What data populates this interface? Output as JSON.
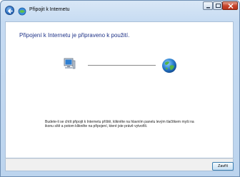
{
  "window": {
    "title": "Připojit k Internetu"
  },
  "main": {
    "heading": "Připojení k Internetu je připraveno k použití.",
    "info_text": "Budete-li se chtít připojit k Internetu příště, klikněte na hlavním panelu levým tlačítkem myši na ikonu sítě a potom klikněte na připojení, které jste právě vytvořili."
  },
  "footer": {
    "close_label": "Zavřít"
  },
  "icons": {
    "back": "back-arrow-icon",
    "app": "network-icon",
    "computer": "computer-icon",
    "internet": "globe-icon"
  },
  "colors": {
    "heading": "#1e3287",
    "titlebar": "#c6dbf2",
    "close_window": "#c8452c"
  }
}
